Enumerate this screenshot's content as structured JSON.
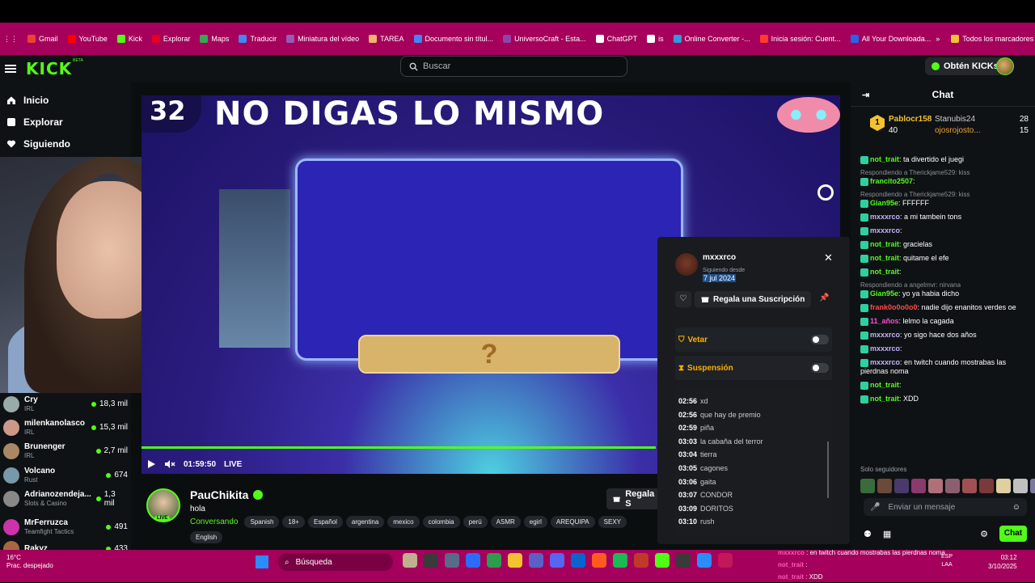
{
  "bookmarks": [
    {
      "label": "Gmail",
      "color": "#ea4335"
    },
    {
      "label": "YouTube",
      "color": "#ff0000"
    },
    {
      "label": "Kick",
      "color": "#53fc18"
    },
    {
      "label": "Explorar",
      "color": "#e60023"
    },
    {
      "label": "Maps",
      "color": "#34a853"
    },
    {
      "label": "Traducir",
      "color": "#4285f4"
    },
    {
      "label": "Miniatura del vídeo",
      "color": "#9b59b6"
    },
    {
      "label": "TAREA",
      "color": "#f6b26b"
    },
    {
      "label": "Documento sin títul...",
      "color": "#4285f4"
    },
    {
      "label": "UniversoCraft - Esta...",
      "color": "#8e44ad"
    },
    {
      "label": "ChatGPT",
      "color": "#ffffff"
    },
    {
      "label": "is",
      "color": "#ffffff"
    },
    {
      "label": "Online Converter -...",
      "color": "#3498db"
    },
    {
      "label": "Inicia sesión: Cuent...",
      "color": "#ff3b30"
    },
    {
      "label": "All Your Downloada...",
      "color": "#2563eb"
    }
  ],
  "bookmarks_more": "»",
  "bookmarks_all": "Todos los marcadores",
  "header": {
    "logo": "KICK",
    "beta": "BETA",
    "search_placeholder": "Buscar",
    "kicks_button": "Obtén KICKs"
  },
  "nav": [
    {
      "label": "Inicio",
      "icon": "home-icon"
    },
    {
      "label": "Explorar",
      "icon": "compass-icon"
    },
    {
      "label": "Siguiendo",
      "icon": "heart-icon"
    }
  ],
  "channels": [
    {
      "name": "Cry",
      "category": "IRL",
      "viewers": "18,3 mil",
      "color": "#9aa"
    },
    {
      "name": "milenkanolasco",
      "category": "IRL",
      "viewers": "15,3 mil",
      "color": "#c98"
    },
    {
      "name": "Brunenger",
      "category": "IRL",
      "viewers": "2,7 mil",
      "color": "#a86"
    },
    {
      "name": "Volcano",
      "category": "Rust",
      "viewers": "674",
      "color": "#79a"
    },
    {
      "name": "Adrianozendeja...",
      "category": "Slots & Casino",
      "viewers": "1,3 mil",
      "color": "#888"
    },
    {
      "name": "MrFerruzca",
      "category": "Teamfight Tactics",
      "viewers": "491",
      "color": "#c3a"
    },
    {
      "name": "Rakyz",
      "category": "",
      "viewers": "433",
      "color": "#a64"
    }
  ],
  "stream": {
    "overlay_number": "32",
    "overlay_title": "NO DIGAS LO MISMO",
    "overlay_side": "NO",
    "pill_text": "?",
    "time": "01:59:50",
    "live": "LIVE",
    "progress": 0.999
  },
  "channel_info": {
    "name": "PauChikita",
    "title": "hola",
    "category": "Conversando",
    "live_badge": "LIVE",
    "tags": [
      "Spanish",
      "18+",
      "Español",
      "argentina",
      "mexico",
      "colombia",
      "perú",
      "ASMR",
      "egirl",
      "AREQUIPA",
      "SEXY",
      "English"
    ],
    "gift_button": "Regala S"
  },
  "popup": {
    "username": "mxxxrco",
    "since_label": "Siguiendo desde",
    "since_date": "7 jul 2024",
    "gift_sub": "Regala una Suscripción",
    "veto_label": "Vetar",
    "suspend_label": "Suspensión",
    "log": [
      {
        "time": "02:56",
        "text": "xd"
      },
      {
        "time": "02:56",
        "text": "que hay de premio"
      },
      {
        "time": "02:59",
        "text": "piña"
      },
      {
        "time": "03:03",
        "text": "la cabaña del terror"
      },
      {
        "time": "03:04",
        "text": "tierra"
      },
      {
        "time": "03:05",
        "text": "cagones"
      },
      {
        "time": "03:06",
        "text": "gaita"
      },
      {
        "time": "03:07",
        "text": "CONDOR"
      },
      {
        "time": "03:09",
        "text": "DORITOS"
      },
      {
        "time": "03:10",
        "text": "rush"
      }
    ]
  },
  "chat": {
    "title": "Chat",
    "leader_rank": "1",
    "leader_name": "Pablocr158",
    "leader_amount": "40",
    "leader_rows": [
      {
        "name": "Stanubis24",
        "count": "28"
      },
      {
        "name": "ojosrojosto...",
        "count": "15"
      }
    ],
    "messages": [
      {
        "reply": "",
        "user": "not_trait",
        "color": "#53fc18",
        "text": ": ta divertido el juegi"
      },
      {
        "reply": "Respondiendo a Therickjame529: kiss",
        "user": "francito2507",
        "color": "#53fc18",
        "text": ":"
      },
      {
        "reply": "Respondiendo a Therickjame529: kiss",
        "user": "Gian95e",
        "color": "#53fc18",
        "text": ": FFFFFF"
      },
      {
        "reply": "",
        "user": "mxxxrco",
        "color": "#c5b3ff",
        "text": ": a mi tambein tons"
      },
      {
        "reply": "",
        "user": "mxxxrco",
        "color": "#c5b3ff",
        "text": ":"
      },
      {
        "reply": "",
        "user": "not_trait",
        "color": "#53fc18",
        "text": ": gracielas"
      },
      {
        "reply": "",
        "user": "not_trait",
        "color": "#53fc18",
        "text": ": quitame el efe"
      },
      {
        "reply": "",
        "user": "not_trait",
        "color": "#53fc18",
        "text": ":"
      },
      {
        "reply": "Respondiendo a angelmvr: nirvana",
        "user": "Gian95e",
        "color": "#53fc18",
        "text": ": yo ya habia dicho"
      },
      {
        "reply": "",
        "user": "frank0o0o0o0",
        "color": "#ff4b4b",
        "text": ": nadie dijo enanitos verdes oe"
      },
      {
        "reply": "",
        "user": "11_años",
        "color": "#ff4bd8",
        "text": ": lelmo la cagada"
      },
      {
        "reply": "",
        "user": "mxxxrco",
        "color": "#c5b3ff",
        "text": ": yo sigo hace dos años"
      },
      {
        "reply": "",
        "user": "mxxxrco",
        "color": "#c5b3ff",
        "text": ":"
      },
      {
        "reply": "",
        "user": "mxxxrco",
        "color": "#c5b3ff",
        "text": ": en twitch cuando mostrabas las pierdnas noma"
      },
      {
        "reply": "",
        "user": "not_trait",
        "color": "#53fc18",
        "text": ":"
      },
      {
        "reply": "",
        "user": "not_trait",
        "color": "#53fc18",
        "text": ": XDD"
      }
    ],
    "only_followers": "Solo seguidores",
    "input_placeholder": "Enviar un mensaje",
    "send_button": "Chat"
  },
  "taskbar": {
    "temp": "16°C",
    "weather": "Prac. despejado",
    "search": "Búsqueda",
    "overlay_lines": [
      {
        "user": "mxxxrco",
        "text": " : en twitch cuando mostrabas las pierdnas noma"
      },
      {
        "user": "not_trait",
        "text": " :"
      },
      {
        "user": "not_trait",
        "text": " : XDD"
      }
    ],
    "lang": "ESP",
    "lang2": "LAA",
    "time": "03:12",
    "date": "3/10/2025"
  }
}
